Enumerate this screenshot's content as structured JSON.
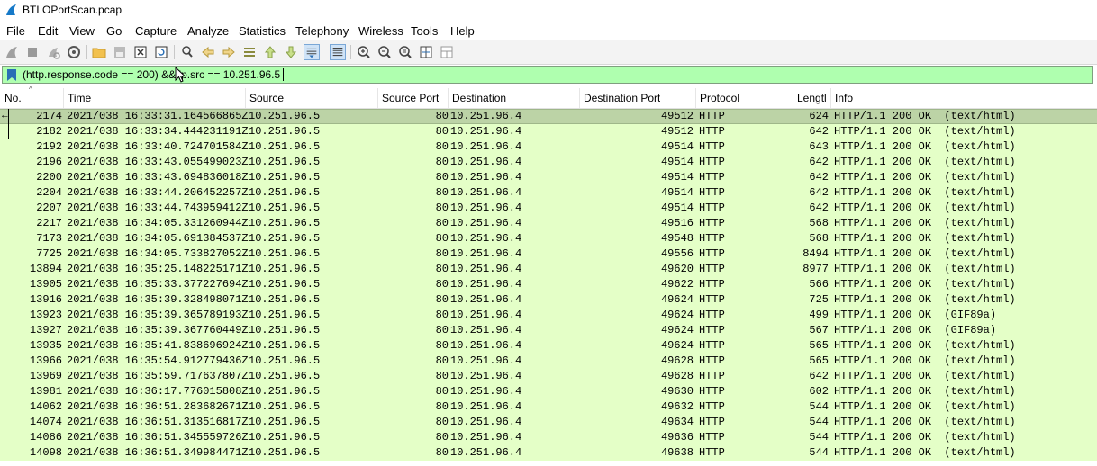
{
  "window": {
    "title": "BTLOPortScan.pcap"
  },
  "menu": [
    "File",
    "Edit",
    "View",
    "Go",
    "Capture",
    "Analyze",
    "Statistics",
    "Telephony",
    "Wireless",
    "Tools",
    "Help"
  ],
  "toolbar_icons": [
    "shark-fin-start-icon",
    "stop-icon",
    "restart-icon",
    "capture-options-icon",
    "open-file-icon",
    "save-file-icon",
    "close-file-icon",
    "reload-icon",
    "find-packet-icon",
    "go-back-icon",
    "go-forward-icon",
    "go-to-packet-icon",
    "go-first-icon",
    "go-last-icon",
    "autoscroll-icon",
    "colorize-icon",
    "zoom-in-icon",
    "zoom-out-icon",
    "zoom-normal-icon",
    "resize-columns-icon",
    "layout-icon"
  ],
  "filter": {
    "value": "(http.response.code == 200) && ip.src == 10.251.96.5"
  },
  "columns": [
    "No.",
    "Time",
    "Source",
    "Source Port",
    "Destination",
    "Destination Port",
    "Protocol",
    "Lengtl",
    "Info"
  ],
  "packets": [
    {
      "no": "2174",
      "time": "2021/038 16:33:31.164566865Z",
      "src": "10.251.96.5",
      "sport": "80",
      "dst": "10.251.96.4",
      "dport": "49512",
      "proto": "HTTP",
      "len": "624",
      "info": "HTTP/1.1 200 OK  (text/html)"
    },
    {
      "no": "2182",
      "time": "2021/038 16:33:34.444231191Z",
      "src": "10.251.96.5",
      "sport": "80",
      "dst": "10.251.96.4",
      "dport": "49512",
      "proto": "HTTP",
      "len": "642",
      "info": "HTTP/1.1 200 OK  (text/html)"
    },
    {
      "no": "2192",
      "time": "2021/038 16:33:40.724701584Z",
      "src": "10.251.96.5",
      "sport": "80",
      "dst": "10.251.96.4",
      "dport": "49514",
      "proto": "HTTP",
      "len": "643",
      "info": "HTTP/1.1 200 OK  (text/html)"
    },
    {
      "no": "2196",
      "time": "2021/038 16:33:43.055499023Z",
      "src": "10.251.96.5",
      "sport": "80",
      "dst": "10.251.96.4",
      "dport": "49514",
      "proto": "HTTP",
      "len": "642",
      "info": "HTTP/1.1 200 OK  (text/html)"
    },
    {
      "no": "2200",
      "time": "2021/038 16:33:43.694836018Z",
      "src": "10.251.96.5",
      "sport": "80",
      "dst": "10.251.96.4",
      "dport": "49514",
      "proto": "HTTP",
      "len": "642",
      "info": "HTTP/1.1 200 OK  (text/html)"
    },
    {
      "no": "2204",
      "time": "2021/038 16:33:44.206452257Z",
      "src": "10.251.96.5",
      "sport": "80",
      "dst": "10.251.96.4",
      "dport": "49514",
      "proto": "HTTP",
      "len": "642",
      "info": "HTTP/1.1 200 OK  (text/html)"
    },
    {
      "no": "2207",
      "time": "2021/038 16:33:44.743959412Z",
      "src": "10.251.96.5",
      "sport": "80",
      "dst": "10.251.96.4",
      "dport": "49514",
      "proto": "HTTP",
      "len": "642",
      "info": "HTTP/1.1 200 OK  (text/html)"
    },
    {
      "no": "2217",
      "time": "2021/038 16:34:05.331260944Z",
      "src": "10.251.96.5",
      "sport": "80",
      "dst": "10.251.96.4",
      "dport": "49516",
      "proto": "HTTP",
      "len": "568",
      "info": "HTTP/1.1 200 OK  (text/html)"
    },
    {
      "no": "7173",
      "time": "2021/038 16:34:05.691384537Z",
      "src": "10.251.96.5",
      "sport": "80",
      "dst": "10.251.96.4",
      "dport": "49548",
      "proto": "HTTP",
      "len": "568",
      "info": "HTTP/1.1 200 OK  (text/html)"
    },
    {
      "no": "7725",
      "time": "2021/038 16:34:05.733827052Z",
      "src": "10.251.96.5",
      "sport": "80",
      "dst": "10.251.96.4",
      "dport": "49556",
      "proto": "HTTP",
      "len": "8494",
      "info": "HTTP/1.1 200 OK  (text/html)"
    },
    {
      "no": "13894",
      "time": "2021/038 16:35:25.148225171Z",
      "src": "10.251.96.5",
      "sport": "80",
      "dst": "10.251.96.4",
      "dport": "49620",
      "proto": "HTTP",
      "len": "8977",
      "info": "HTTP/1.1 200 OK  (text/html)"
    },
    {
      "no": "13905",
      "time": "2021/038 16:35:33.377227694Z",
      "src": "10.251.96.5",
      "sport": "80",
      "dst": "10.251.96.4",
      "dport": "49622",
      "proto": "HTTP",
      "len": "566",
      "info": "HTTP/1.1 200 OK  (text/html)"
    },
    {
      "no": "13916",
      "time": "2021/038 16:35:39.328498071Z",
      "src": "10.251.96.5",
      "sport": "80",
      "dst": "10.251.96.4",
      "dport": "49624",
      "proto": "HTTP",
      "len": "725",
      "info": "HTTP/1.1 200 OK  (text/html)"
    },
    {
      "no": "13923",
      "time": "2021/038 16:35:39.365789193Z",
      "src": "10.251.96.5",
      "sport": "80",
      "dst": "10.251.96.4",
      "dport": "49624",
      "proto": "HTTP",
      "len": "499",
      "info": "HTTP/1.1 200 OK  (GIF89a)"
    },
    {
      "no": "13927",
      "time": "2021/038 16:35:39.367760449Z",
      "src": "10.251.96.5",
      "sport": "80",
      "dst": "10.251.96.4",
      "dport": "49624",
      "proto": "HTTP",
      "len": "567",
      "info": "HTTP/1.1 200 OK  (GIF89a)"
    },
    {
      "no": "13935",
      "time": "2021/038 16:35:41.838696924Z",
      "src": "10.251.96.5",
      "sport": "80",
      "dst": "10.251.96.4",
      "dport": "49624",
      "proto": "HTTP",
      "len": "565",
      "info": "HTTP/1.1 200 OK  (text/html)"
    },
    {
      "no": "13966",
      "time": "2021/038 16:35:54.912779436Z",
      "src": "10.251.96.5",
      "sport": "80",
      "dst": "10.251.96.4",
      "dport": "49628",
      "proto": "HTTP",
      "len": "565",
      "info": "HTTP/1.1 200 OK  (text/html)"
    },
    {
      "no": "13969",
      "time": "2021/038 16:35:59.717637807Z",
      "src": "10.251.96.5",
      "sport": "80",
      "dst": "10.251.96.4",
      "dport": "49628",
      "proto": "HTTP",
      "len": "642",
      "info": "HTTP/1.1 200 OK  (text/html)"
    },
    {
      "no": "13981",
      "time": "2021/038 16:36:17.776015808Z",
      "src": "10.251.96.5",
      "sport": "80",
      "dst": "10.251.96.4",
      "dport": "49630",
      "proto": "HTTP",
      "len": "602",
      "info": "HTTP/1.1 200 OK  (text/html)"
    },
    {
      "no": "14062",
      "time": "2021/038 16:36:51.283682671Z",
      "src": "10.251.96.5",
      "sport": "80",
      "dst": "10.251.96.4",
      "dport": "49632",
      "proto": "HTTP",
      "len": "544",
      "info": "HTTP/1.1 200 OK  (text/html)"
    },
    {
      "no": "14074",
      "time": "2021/038 16:36:51.313516817Z",
      "src": "10.251.96.5",
      "sport": "80",
      "dst": "10.251.96.4",
      "dport": "49634",
      "proto": "HTTP",
      "len": "544",
      "info": "HTTP/1.1 200 OK  (text/html)"
    },
    {
      "no": "14086",
      "time": "2021/038 16:36:51.345559726Z",
      "src": "10.251.96.5",
      "sport": "80",
      "dst": "10.251.96.4",
      "dport": "49636",
      "proto": "HTTP",
      "len": "544",
      "info": "HTTP/1.1 200 OK  (text/html)"
    },
    {
      "no": "14098",
      "time": "2021/038 16:36:51.349984471Z",
      "src": "10.251.96.5",
      "sport": "80",
      "dst": "10.251.96.4",
      "dport": "49638",
      "proto": "HTTP",
      "len": "544",
      "info": "HTTP/1.1 200 OK  (text/html)"
    }
  ],
  "colors": {
    "row_bg": "#e4ffc7",
    "selected_bg": "#bcd3a6",
    "filter_bg": "#afffaf"
  }
}
